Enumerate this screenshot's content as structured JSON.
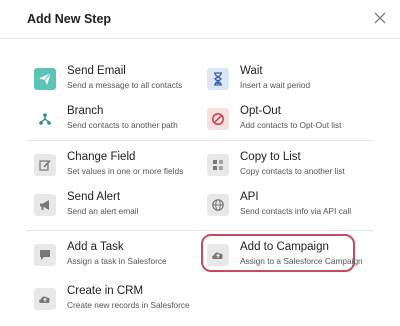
{
  "dialog": {
    "title": "Add New Step"
  },
  "items": {
    "send_email": {
      "label": "Send Email",
      "desc": "Send a message to all contacts",
      "icon": "paper-plane-icon"
    },
    "wait": {
      "label": "Wait",
      "desc": "Insert a wait period",
      "icon": "hourglass-icon"
    },
    "branch": {
      "label": "Branch",
      "desc": "Send contacts to another path",
      "icon": "branch-icon"
    },
    "opt_out": {
      "label": "Opt-Out",
      "desc": "Add contacts to Opt-Out list",
      "icon": "no-entry-icon"
    },
    "change_field": {
      "label": "Change Field",
      "desc": "Set values in one or more fields",
      "icon": "edit-icon"
    },
    "copy_to_list": {
      "label": "Copy to List",
      "desc": "Copy contacts to another list",
      "icon": "copy-list-icon"
    },
    "send_alert": {
      "label": "Send Alert",
      "desc": "Send an alert email",
      "icon": "megaphone-icon"
    },
    "api": {
      "label": "API",
      "desc": "Send contacts info via API call",
      "icon": "globe-icon"
    },
    "add_task": {
      "label": "Add a Task",
      "desc": "Assign a task in Salesforce",
      "icon": "chat-icon"
    },
    "add_campaign": {
      "label": "Add to Campaign",
      "desc": "Assign to a Salesforce Campaign",
      "icon": "cloud-upload-icon"
    },
    "create_crm": {
      "label": "Create in CRM",
      "desc": "Create new records in Salesforce",
      "icon": "cloud-upload-icon"
    }
  },
  "colors": {
    "email_icon_bg": "#5ac4b7",
    "blue_icon_bg": "#dde6f3",
    "red_icon_bg": "#f8dfe0",
    "grey_icon_bg": "#e8e8e8",
    "highlight": "#c54b63"
  }
}
